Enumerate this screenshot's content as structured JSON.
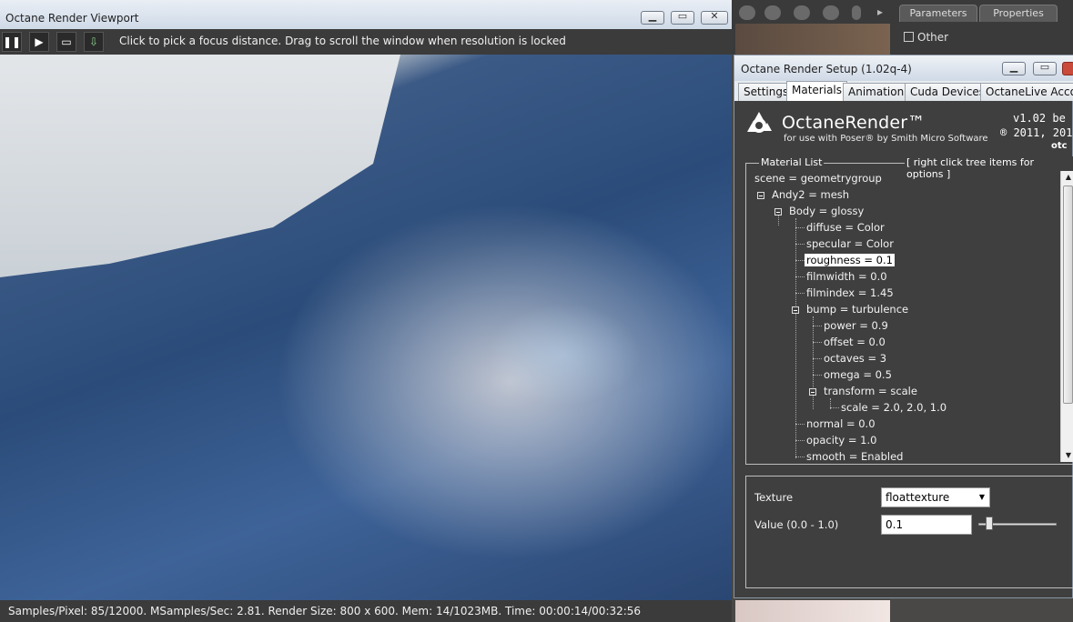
{
  "viewport": {
    "title": "Octane Render Viewport",
    "hint": "Click to pick a focus distance.  Drag to scroll the window when resolution is locked",
    "status": "Samples/Pixel: 85/12000. MSamples/Sec: 2.81. Render Size: 800 x 600. Mem: 14/1023MB. Time: 00:00:14/00:32:56",
    "toolbar_icons": [
      "pause-icon",
      "play-icon",
      "monitor-icon",
      "save-image-icon"
    ]
  },
  "poser": {
    "tabs": [
      "Parameters",
      "Properties"
    ],
    "group_label": "Other"
  },
  "setup": {
    "title": "Octane Render Setup (1.02q-4)",
    "tabs": [
      "Settings",
      "Materials",
      "Animation",
      "Cuda Devices",
      "OctaneLive Accou"
    ],
    "active_tab": "Materials",
    "logo": {
      "name": "OctaneRender™",
      "subtitle": "for use with Poser® by Smith Micro Software",
      "version": "v1.02 be",
      "year": "® 2011, 201",
      "brand": "otc"
    },
    "material_list": {
      "legend": "Material List",
      "hint": "[ right click tree items for options ]",
      "items": [
        {
          "label": "scene = geometrygroup"
        },
        {
          "label": "Andy2 = mesh"
        },
        {
          "label": "Body = glossy"
        },
        {
          "label": "diffuse = Color"
        },
        {
          "label": "specular = Color"
        },
        {
          "label": "roughness = 0.1",
          "selected": true
        },
        {
          "label": "filmwidth = 0.0"
        },
        {
          "label": "filmindex = 1.45"
        },
        {
          "label": "bump = turbulence"
        },
        {
          "label": "power = 0.9"
        },
        {
          "label": "offset = 0.0"
        },
        {
          "label": "octaves = 3"
        },
        {
          "label": "omega = 0.5"
        },
        {
          "label": "transform = scale"
        },
        {
          "label": "scale = 2.0, 2.0, 1.0"
        },
        {
          "label": "normal = 0.0"
        },
        {
          "label": "opacity = 1.0"
        },
        {
          "label": "smooth = Enabled"
        }
      ]
    },
    "properties": {
      "texture_label": "Texture",
      "texture_value": "floattexture",
      "value_label": "Value (0.0 - 1.0)",
      "value": "0.1",
      "slider_level": 0.1
    }
  },
  "colors": {
    "dialog_bg": "#3f3f3f",
    "selected_bg": "#ffffff"
  }
}
